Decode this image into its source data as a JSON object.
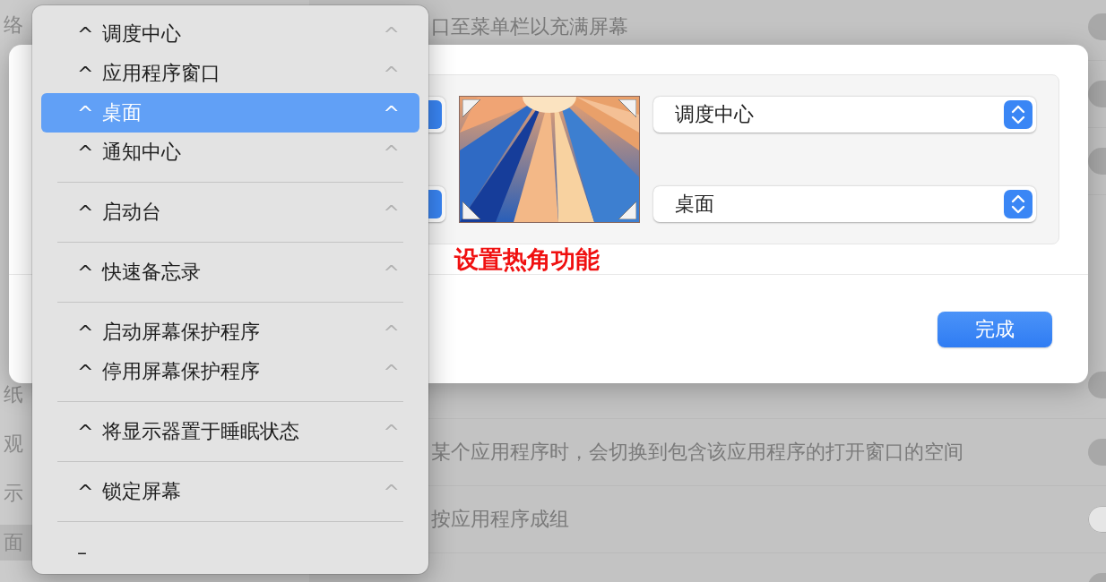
{
  "sidebar": {
    "items": [
      {
        "label": "络",
        "selected": false
      },
      {
        "label": "纸",
        "selected": false
      },
      {
        "label": "观",
        "selected": false
      },
      {
        "label": "示",
        "selected": false
      },
      {
        "label": "面",
        "selected": true
      }
    ]
  },
  "settings_rows": [
    {
      "label": "口至菜单栏以充满屏幕",
      "on": true
    },
    {
      "on": true
    },
    {
      "on": true
    },
    {
      "on": true
    },
    {
      "label": "某个应用程序时，会切换到包含该应用程序的打开窗口的空间",
      "on": true
    },
    {
      "label": "按应用程序成组",
      "on": false
    },
    {
      "on": true
    }
  ],
  "dialog": {
    "top_right_corner": "调度中心",
    "bottom_right_corner": "桌面",
    "annotation": "设置热角功能",
    "done_button": "完成"
  },
  "menu": {
    "groups": [
      [
        {
          "prefix": "^",
          "label": "调度中心",
          "shortcut": "^",
          "selected": false
        },
        {
          "prefix": "^",
          "label": "应用程序窗口",
          "shortcut": "^",
          "selected": false
        },
        {
          "prefix": "^",
          "label": "桌面",
          "shortcut": "^",
          "selected": true
        },
        {
          "prefix": "^",
          "label": "通知中心",
          "shortcut": "^",
          "selected": false
        }
      ],
      [
        {
          "prefix": "^",
          "label": "启动台",
          "shortcut": "^",
          "selected": false
        }
      ],
      [
        {
          "prefix": "^",
          "label": "快速备忘录",
          "shortcut": "^",
          "selected": false
        }
      ],
      [
        {
          "prefix": "^",
          "label": "启动屏幕保护程序",
          "shortcut": "^",
          "selected": false
        },
        {
          "prefix": "^",
          "label": "停用屏幕保护程序",
          "shortcut": "^",
          "selected": false
        }
      ],
      [
        {
          "prefix": "^",
          "label": "将显示器置于睡眠状态",
          "shortcut": "^",
          "selected": false
        }
      ],
      [
        {
          "prefix": "^",
          "label": "锁定屏幕",
          "shortcut": "^",
          "selected": false
        }
      ],
      [
        {
          "label": "–",
          "selected": false
        }
      ]
    ]
  }
}
